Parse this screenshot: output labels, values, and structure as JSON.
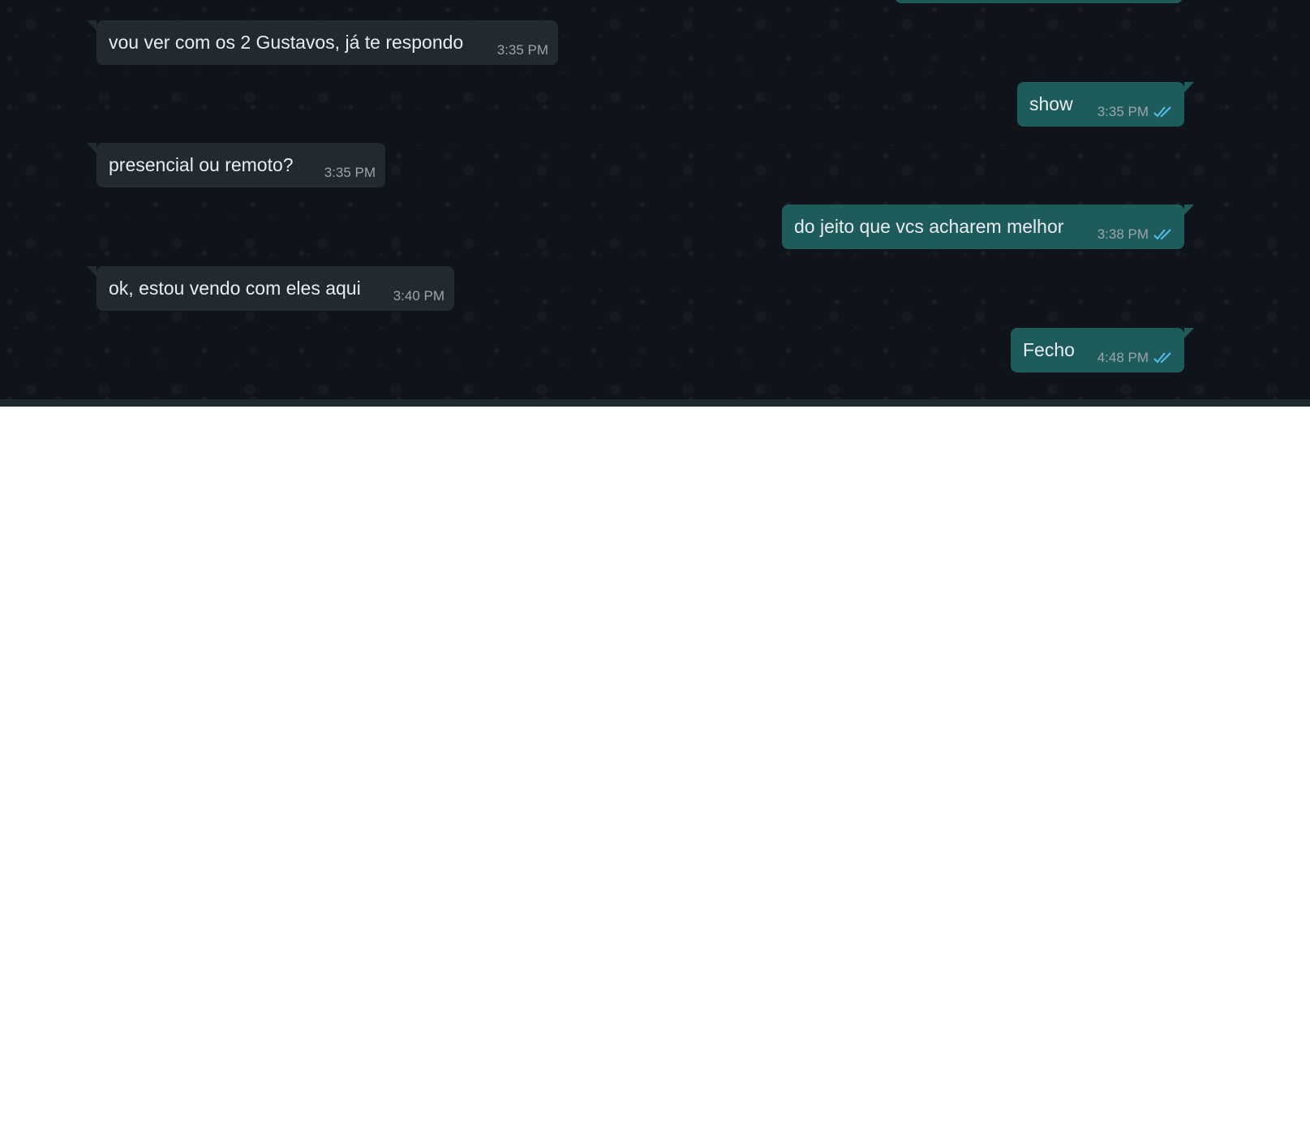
{
  "messages": [
    {
      "direction": "incoming",
      "text": "vou ver com os 2 Gustavos, já te respondo",
      "time": "3:35 PM"
    },
    {
      "direction": "outgoing",
      "text": "show",
      "time": "3:35 PM",
      "status": "read-double-check"
    },
    {
      "direction": "incoming",
      "text": "presencial ou remoto?",
      "time": "3:35 PM"
    },
    {
      "direction": "outgoing",
      "text": "do jeito que vcs acharem melhor",
      "time": "3:38 PM",
      "status": "read-double-check"
    },
    {
      "direction": "incoming",
      "text": "ok, estou vendo com eles aqui",
      "time": "3:40 PM"
    },
    {
      "direction": "outgoing",
      "text": "Fecho",
      "time": "4:48 PM",
      "status": "read-double-check"
    }
  ],
  "colors": {
    "chat_background": "#0e1419",
    "incoming_bubble": "#212a30",
    "outgoing_bubble": "#1e5c5c",
    "text": "#e9edef",
    "timestamp": "#9ba5ab",
    "read_tick": "#53bdeb"
  },
  "icons": {
    "read_status": "double-check-icon"
  }
}
